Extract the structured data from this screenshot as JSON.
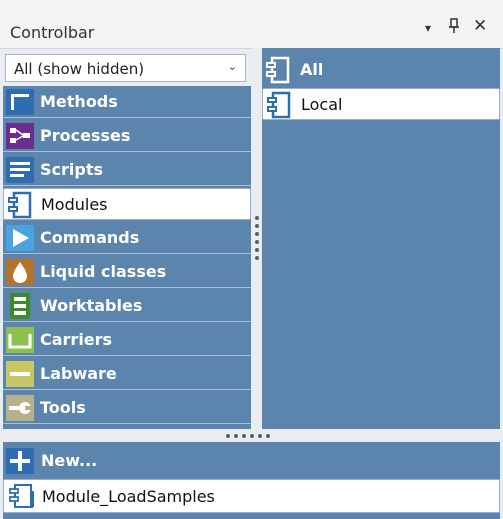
{
  "window": {
    "title": "Controlbar",
    "buttons": {
      "dropdown": "▾",
      "pin": "ᛘ",
      "close": "✕"
    }
  },
  "filter": {
    "value": "All (show hidden)",
    "chevron": "⌄"
  },
  "categories": [
    {
      "label": "Methods",
      "icon": "methods-icon",
      "color": "#2f6db3"
    },
    {
      "label": "Processes",
      "icon": "processes-icon",
      "color": "#6b2d8f"
    },
    {
      "label": "Scripts",
      "icon": "scripts-icon",
      "color": "#2f6db3"
    },
    {
      "label": "Modules",
      "icon": "modules-icon",
      "color": "#2f6db3"
    },
    {
      "label": "Commands",
      "icon": "commands-icon",
      "color": "#4aa3df"
    },
    {
      "label": "Liquid classes",
      "icon": "liquid-classes-icon",
      "color": "#b8712a"
    },
    {
      "label": "Worktables",
      "icon": "worktables-icon",
      "color": "#3c8c2c"
    },
    {
      "label": "Carriers",
      "icon": "carriers-icon",
      "color": "#8dc04d"
    },
    {
      "label": "Labware",
      "icon": "labware-icon",
      "color": "#c9c765"
    },
    {
      "label": "Tools",
      "icon": "tools-icon",
      "color": "#b7b08a"
    }
  ],
  "selected_category": "Modules",
  "right_list": {
    "header": "All",
    "items": [
      "Local"
    ]
  },
  "bottom": {
    "new_label": "New...",
    "items": [
      "Module_LoadSamples"
    ]
  },
  "colors": {
    "pane": "#5c85ad",
    "accent": "#2f6db3"
  }
}
